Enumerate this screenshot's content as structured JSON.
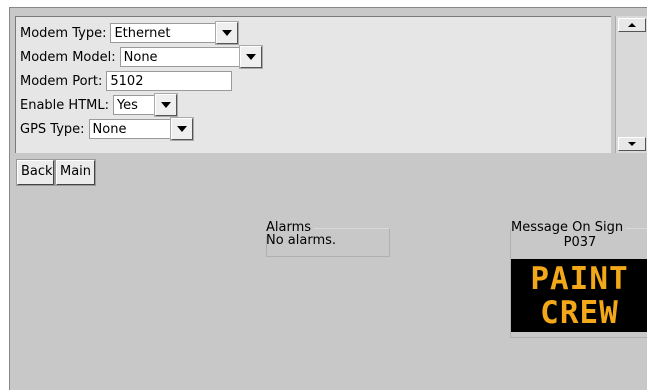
{
  "settings": {
    "modem_type": {
      "label": "Modem Type:",
      "value": "Ethernet"
    },
    "modem_model": {
      "label": "Modem Model:",
      "value": "None"
    },
    "modem_port": {
      "label": "Modem Port:",
      "value": "5102"
    },
    "enable_html": {
      "label": "Enable HTML:",
      "value": "Yes"
    },
    "gps_type": {
      "label": "GPS Type:",
      "value": "None"
    }
  },
  "nav": {
    "back_label": "Back",
    "main_label": "Main"
  },
  "alarms": {
    "title": "Alarms",
    "status": "No alarms."
  },
  "sign": {
    "title": "Message On Sign",
    "id": "P037",
    "lines": [
      "PAINT",
      "CREW"
    ],
    "text_color": "#f3a81a"
  },
  "icons": {
    "dropdown": "chevron-down-icon",
    "scroll_up": "scroll-up-icon",
    "scroll_down": "scroll-down-icon"
  }
}
